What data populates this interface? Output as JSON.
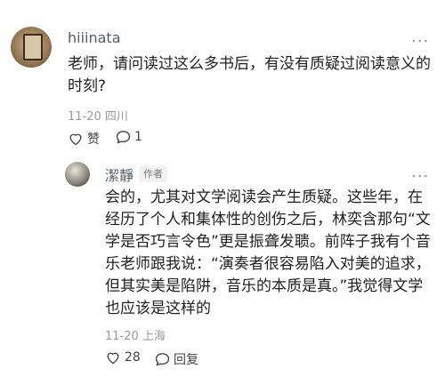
{
  "comment": {
    "username": "hiiinata",
    "text_line1": "老师，请问读过这么多书后，有没有质疑过阅读意义的",
    "text_line2": "时刻?",
    "meta": "11-20 四川",
    "like_label": "赞",
    "reply_count": "1",
    "more_label": "···"
  },
  "reply": {
    "username": "潔靜",
    "author_tag": "作者",
    "lines": [
      "会的，尤其对文学阅读会产生质疑。这些年，在",
      "经历了个人和集体性的创伤之后，林奕含那句“文",
      "学是否巧言令色”更是振聋发聩。前阵子我有个音",
      "乐老师跟我说：“演奏者很容易陷入对美的追求，",
      "但其实美是陷阱，音乐的本质是真。”我觉得文学",
      "也应该是这样的"
    ],
    "meta": "11-20 上海",
    "like_count": "28",
    "reply_label": "回复",
    "more_label": "···"
  },
  "icons": {
    "heart": "heart-icon",
    "bubble": "comment-bubble-icon",
    "more": "more-dots-icon"
  }
}
